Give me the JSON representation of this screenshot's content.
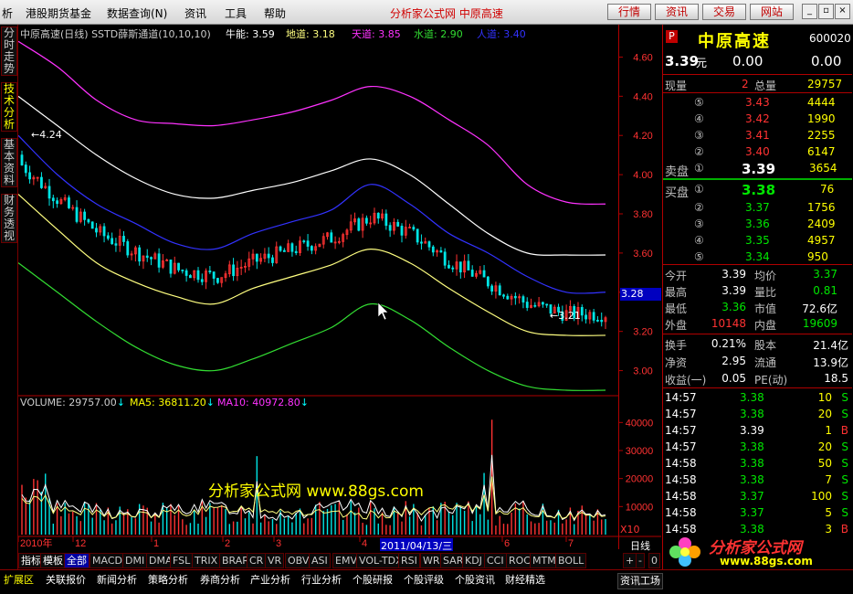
{
  "menu": {
    "items": [
      "析",
      "港股期货基金",
      "数据查询(N)",
      "资讯",
      "工具",
      "帮助"
    ],
    "site_title": "分析家公式网 中原高速",
    "right_buttons": [
      "行情",
      "资讯",
      "交易",
      "网站"
    ]
  },
  "left_tabs": [
    "分时走势",
    "技术分析",
    "基本资料",
    "财务透视"
  ],
  "chart": {
    "legend_prefix": "中原高速(日线) SSTD薛斯通道(10,10,10)",
    "niu_label": "牛能: 3.59",
    "di_label": "地道: 3.18",
    "tian_label": "天道: 3.85",
    "shui_label": "水道: 2.90",
    "ren_label": "人道: 3.40",
    "high_label": "4.24",
    "low_label": "3.21",
    "current_price_tag": "3.28",
    "watermark": "分析家公式网 www.88gs.com",
    "y_ticks": [
      "4.60",
      "4.40",
      "4.20",
      "4.00",
      "3.80",
      "3.60",
      "3.40",
      "3.20",
      "3.00"
    ],
    "vol_legend": {
      "vol": "VOLUME: 29757.00",
      "ma5": "MA5: 36811.20",
      "ma10": "MA10: 40972.80"
    },
    "vol_ticks": [
      "40000",
      "30000",
      "20000",
      "10000"
    ],
    "vol_unit": "X10",
    "x_labels": [
      "2010年",
      "12",
      "1",
      "2",
      "3",
      "4",
      "5",
      "6",
      "7"
    ],
    "cursor_date": "2011/04/13/三",
    "period": "日线",
    "colors": {
      "up": "#ff3232",
      "down": "#00e5e5",
      "tian": "#ff32ff",
      "niu": "#ffffff",
      "ren": "#3232ff",
      "di": "#ffff80",
      "shui": "#32dc32"
    }
  },
  "chart_data": {
    "type": "line",
    "title": "中原高速(日线) SSTD薛斯通道(10,10,10)",
    "series": [
      {
        "name": "天道",
        "values": [
          4.68,
          4.55,
          4.38,
          4.28,
          4.26,
          4.25,
          4.28,
          4.32,
          4.38,
          4.45,
          4.4,
          4.28,
          4.15,
          3.95,
          3.86,
          3.85
        ]
      },
      {
        "name": "牛能",
        "values": [
          4.4,
          4.25,
          4.1,
          3.98,
          3.9,
          3.88,
          3.92,
          3.96,
          4.02,
          4.08,
          4.0,
          3.85,
          3.7,
          3.6,
          3.59,
          3.59
        ]
      },
      {
        "name": "人道",
        "values": [
          4.2,
          4.0,
          3.85,
          3.75,
          3.65,
          3.62,
          3.7,
          3.76,
          3.82,
          3.95,
          3.85,
          3.7,
          3.6,
          3.48,
          3.4,
          3.4
        ]
      },
      {
        "name": "地道",
        "values": [
          3.9,
          3.72,
          3.55,
          3.45,
          3.38,
          3.34,
          3.42,
          3.48,
          3.54,
          3.62,
          3.55,
          3.42,
          3.3,
          3.2,
          3.18,
          3.18
        ]
      },
      {
        "name": "水道",
        "values": [
          3.55,
          3.4,
          3.25,
          3.12,
          3.03,
          3.0,
          3.06,
          3.14,
          3.22,
          3.34,
          3.26,
          3.12,
          3.0,
          2.92,
          2.9,
          2.9
        ]
      }
    ],
    "ylim": [
      2.9,
      4.7
    ],
    "volume": {
      "current": 29757,
      "ma5": 36811.2,
      "ma10": 40972.8,
      "ylim": [
        0,
        45000
      ]
    }
  },
  "quote": {
    "badge": "P",
    "name": "中原高速",
    "code": "600020",
    "price": "3.39",
    "price_unit": "元",
    "change": "0.00",
    "change_pct": "0.00",
    "xianliang_label": "现量",
    "xianliang": "2",
    "zongliang_label": "总量",
    "zongliang": "29757",
    "sell": [
      {
        "lvl": "⑤",
        "price": "3.43",
        "vol": "4444"
      },
      {
        "lvl": "④",
        "price": "3.42",
        "vol": "1990"
      },
      {
        "lvl": "③",
        "price": "3.41",
        "vol": "2255"
      },
      {
        "lvl": "②",
        "price": "3.40",
        "vol": "6147"
      },
      {
        "lvl": "①",
        "price": "3.39",
        "vol": "3654"
      }
    ],
    "sell_label": "卖盘",
    "buy_label": "买盘",
    "buy": [
      {
        "lvl": "①",
        "price": "3.38",
        "vol": "76"
      },
      {
        "lvl": "②",
        "price": "3.37",
        "vol": "1756"
      },
      {
        "lvl": "③",
        "price": "3.36",
        "vol": "2409"
      },
      {
        "lvl": "④",
        "price": "3.35",
        "vol": "4957"
      },
      {
        "lvl": "⑤",
        "price": "3.34",
        "vol": "950"
      }
    ],
    "stats": [
      {
        "l1": "今开",
        "v1": "3.39",
        "l2": "均价",
        "v2": "3.37"
      },
      {
        "l1": "最高",
        "v1": "3.39",
        "l2": "量比",
        "v2": "0.81"
      },
      {
        "l1": "最低",
        "v1": "3.36",
        "l2": "市值",
        "v2": "72.6亿"
      },
      {
        "l1": "外盘",
        "v1": "10148",
        "l2": "内盘",
        "v2": "19609"
      }
    ],
    "stats2": [
      {
        "l1": "换手",
        "v1": "0.21%",
        "l2": "股本",
        "v2": "21.4亿"
      },
      {
        "l1": "净资",
        "v1": "2.95",
        "l2": "流通",
        "v2": "13.9亿"
      },
      {
        "l1": "收益(一)",
        "v1": "0.05",
        "l2": "PE(动)",
        "v2": "18.5"
      }
    ],
    "ticks": [
      {
        "time": "14:57",
        "price": "3.38",
        "vol": "10",
        "bs": "S"
      },
      {
        "time": "14:57",
        "price": "3.38",
        "vol": "20",
        "bs": "S"
      },
      {
        "time": "14:57",
        "price": "3.39",
        "vol": "1",
        "bs": "B"
      },
      {
        "time": "14:57",
        "price": "3.38",
        "vol": "20",
        "bs": "S"
      },
      {
        "time": "14:58",
        "price": "3.38",
        "vol": "50",
        "bs": "S"
      },
      {
        "time": "14:58",
        "price": "3.38",
        "vol": "7",
        "bs": "S"
      },
      {
        "time": "14:58",
        "price": "3.37",
        "vol": "100",
        "bs": "S"
      },
      {
        "time": "14:58",
        "price": "3.37",
        "vol": "5",
        "bs": "S"
      },
      {
        "time": "14:58",
        "price": "3.38",
        "vol": "3",
        "bs": "B"
      }
    ],
    "logo_text": "分析家公式网",
    "logo_url": "www.88gs.com"
  },
  "indicator_tabs": [
    "指标",
    "模板",
    "全部",
    "MACD",
    "DMI",
    "DMA",
    "FSL",
    "TRIX",
    "BRAR",
    "CR",
    "VR",
    "OBV",
    "ASI",
    "EMV",
    "VOL-TDX",
    "RSI",
    "WR",
    "SAR",
    "KDJ",
    "CCI",
    "ROC",
    "MTM",
    "BOLL"
  ],
  "nav_controls": [
    "+",
    "-",
    "0"
  ],
  "function_tabs": [
    "扩展区",
    "关联报价",
    "新闻分析",
    "策略分析",
    "券商分析",
    "产业分析",
    "行业分析",
    "个股研报",
    "个股评级",
    "个股资讯",
    "财经精选"
  ],
  "function_right": "资讯工场"
}
